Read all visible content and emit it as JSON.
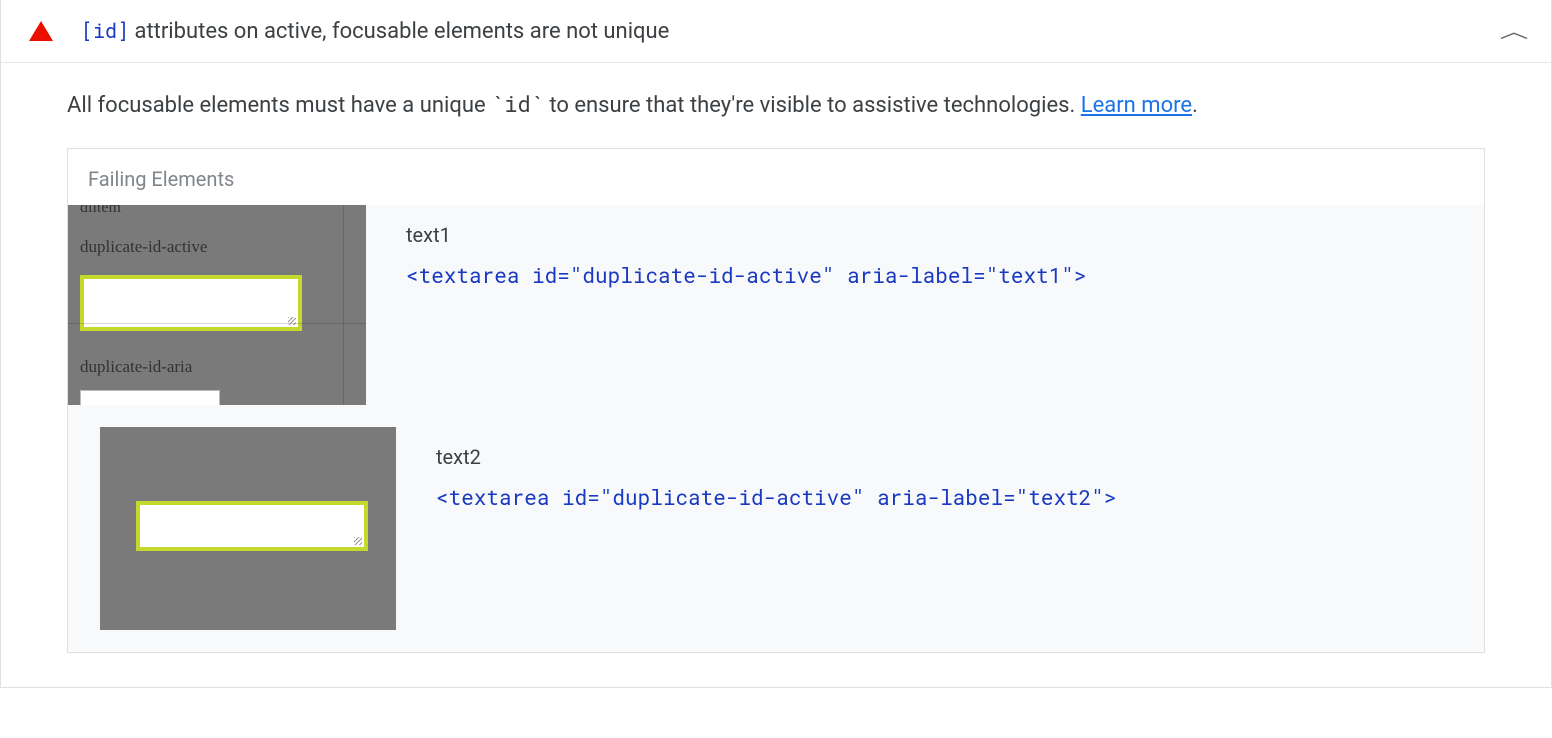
{
  "audit": {
    "code_label": "[id]",
    "title_suffix": " attributes on active, focusable elements are not unique",
    "description_prefix": "All focusable elements must have a unique ",
    "description_code": "`id`",
    "description_suffix": " to ensure that they're visible to assistive technologies. ",
    "learn_more": "Learn more",
    "period": "."
  },
  "failing": {
    "heading": "Failing Elements",
    "items": [
      {
        "label": "text1",
        "code": "<textarea id=\"duplicate-id-active\" aria-label=\"text1\">",
        "thumb_label1": "duplicate-id-active",
        "thumb_label2": "duplicate-id-aria",
        "thumb_top": "dlitem"
      },
      {
        "label": "text2",
        "code": "<textarea id=\"duplicate-id-active\" aria-label=\"text2\">"
      }
    ]
  }
}
